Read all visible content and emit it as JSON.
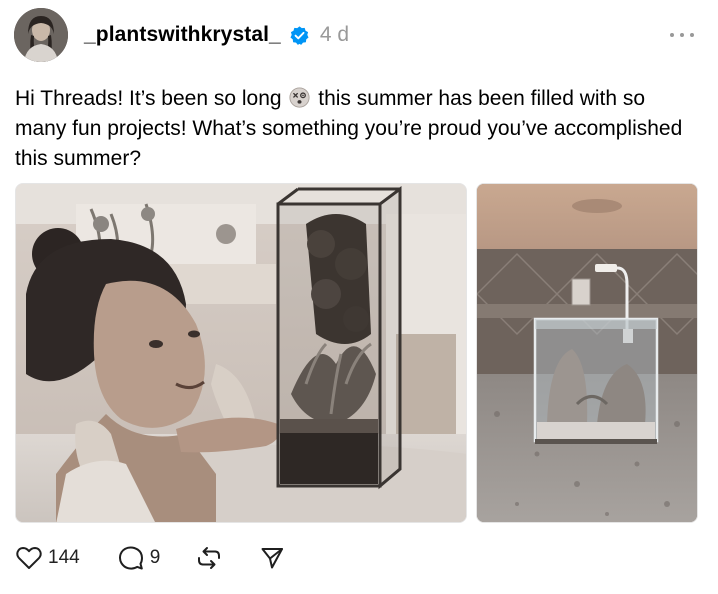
{
  "post": {
    "author": {
      "username": "_plantswithkrystal_",
      "verified": true,
      "avatar_icon": "avatar-photo"
    },
    "timestamp": "4 d",
    "more_icon": "more-dots-icon",
    "text": {
      "part1": "Hi Threads! It’s been so long",
      "emoji": "dizzy-face-emoji",
      "part2": "this summer has been filled with so many fun projects! What’s something you’re proud you’ve accomplished this summer?"
    },
    "media": [
      {
        "type": "photo",
        "subject": "woman-with-tall-glass-terrarium"
      },
      {
        "type": "photo",
        "subject": "glass-aquarium-on-counter"
      }
    ],
    "actions": {
      "like_count": "144",
      "reply_count": "9",
      "like_icon": "heart-icon",
      "reply_icon": "comment-icon",
      "repost_icon": "repost-icon",
      "share_icon": "send-icon"
    }
  },
  "colors": {
    "verified_blue": "#0095f6",
    "meta_gray": "#999999",
    "text": "#000000"
  }
}
